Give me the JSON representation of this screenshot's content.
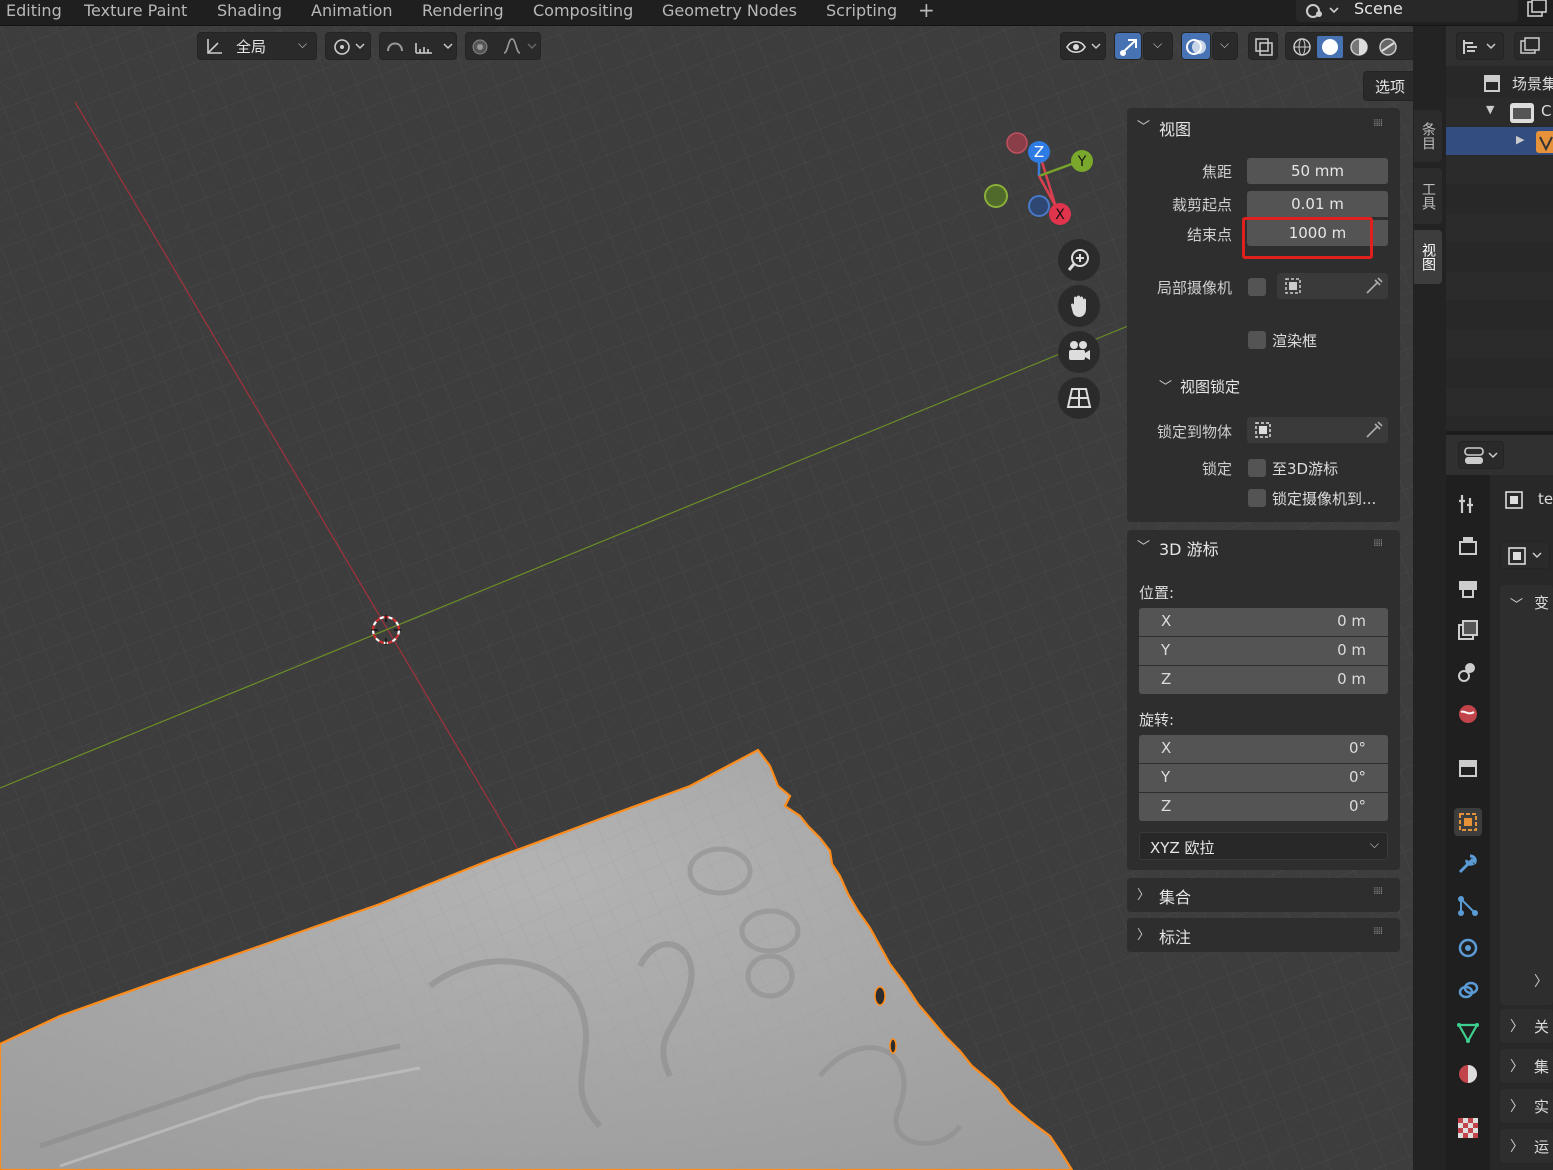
{
  "topbar": {
    "tabs": [
      "Editing",
      "Texture Paint",
      "Shading",
      "Animation",
      "Rendering",
      "Compositing",
      "Geometry Nodes",
      "Scripting"
    ],
    "add_tab": "+",
    "scene_name": "Scene"
  },
  "header": {
    "orientation": "全局",
    "options_label": "选项"
  },
  "gizmo": {
    "x": "X",
    "y": "Y",
    "z": "Z"
  },
  "npanel": {
    "view_section": {
      "title": "视图",
      "focal_length_label": "焦距",
      "focal_length_value": "50 mm",
      "clip_start_label": "裁剪起点",
      "clip_start_value": "0.01 m",
      "clip_end_label": "结束点",
      "clip_end_value": "1000 m",
      "local_camera_label": "局部摄像机",
      "render_region_label": "渲染框"
    },
    "view_lock": {
      "title": "视图锁定",
      "lock_to_object_label": "锁定到物体",
      "lock_label": "锁定",
      "to_3d_cursor_label": "至3D游标",
      "lock_camera_label": "锁定摄像机到..."
    },
    "cursor_section": {
      "title": "3D 游标",
      "location_label": "位置:",
      "location": [
        {
          "axis": "X",
          "value": "0 m"
        },
        {
          "axis": "Y",
          "value": "0 m"
        },
        {
          "axis": "Z",
          "value": "0 m"
        }
      ],
      "rotation_label": "旋转:",
      "rotation": [
        {
          "axis": "X",
          "value": "0°"
        },
        {
          "axis": "Y",
          "value": "0°"
        },
        {
          "axis": "Z",
          "value": "0°"
        }
      ],
      "rotation_mode": "XYZ 欧拉"
    },
    "collections_title": "集合",
    "annotations_title": "标注"
  },
  "side_tabs": [
    "条目",
    "工具",
    "视图"
  ],
  "outliner": {
    "scene_collection": "场景集",
    "collection": "C"
  },
  "properties": {
    "object_name": "te",
    "transform_label": "变",
    "relations_label": "关",
    "collections_label": "集",
    "instancing_label": "实",
    "motion_label": "运"
  },
  "colors": {
    "highlight": "#e0201c",
    "accent": "#4772b3",
    "selection": "#ff8c1a"
  }
}
